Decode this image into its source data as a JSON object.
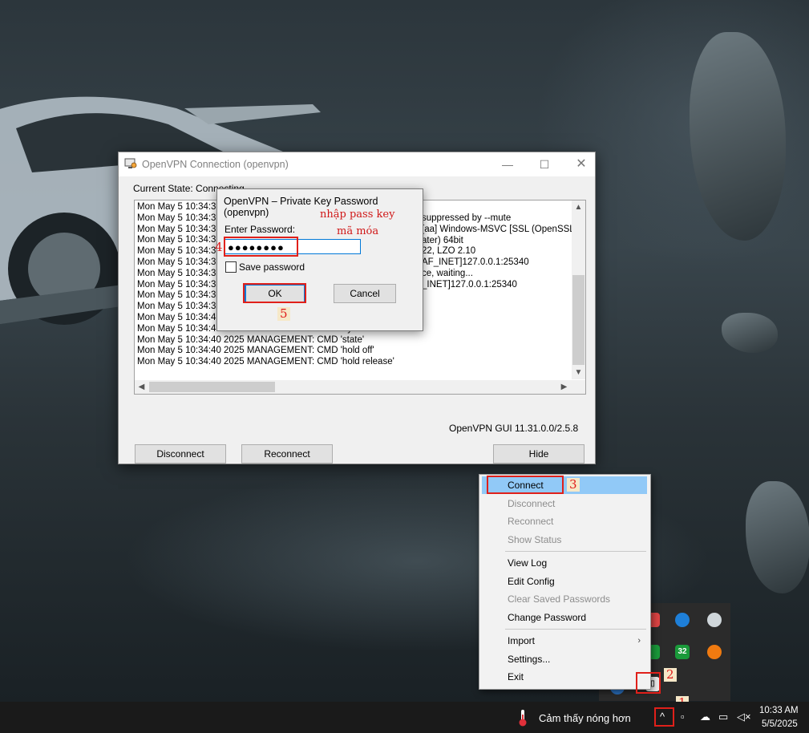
{
  "vpn_window": {
    "title": "OpenVPN Connection (openvpn)",
    "state": "Current State: Connecting",
    "log_left": [
      "Mon May  5 10:34:3",
      "Mon May  5 10:34:3",
      "Mon May  5 10:34:3",
      "Mon May  5 10:34:3",
      "Mon May  5 10:34:3",
      "Mon May  5 10:34:3",
      "Mon May  5 10:34:3",
      "Mon May  5 10:34:3",
      "Mon May  5 10:34:3",
      "Mon May  5 10:34:3",
      "Mon May  5 10:34:4",
      "Mon May  5 10:34:40 2025 MANAGEMENT: CMD 'bytecount 5'",
      "Mon May  5 10:34:40 2025 MANAGEMENT: CMD 'state'",
      "Mon May  5 10:34:40 2025 MANAGEMENT: CMD 'hold off'",
      "Mon May  5 10:34:40 2025 MANAGEMENT: CMD 'hold release'"
    ],
    "log_right": [
      "suppressed by --mute",
      "[aa] Windows-MSVC [SSL (OpenSSL",
      "ater) 64bit",
      "22, LZO 2.10",
      "AF_INET]127.0.0.1:25340",
      "ce, waiting...",
      "_INET]127.0.0.1:25340"
    ],
    "version": "OpenVPN GUI 11.31.0.0/2.5.8",
    "buttons": {
      "disconnect": "Disconnect",
      "reconnect": "Reconnect",
      "hide": "Hide"
    }
  },
  "password_dialog": {
    "title": "OpenVPN – Private Key Password (openvpn)",
    "label": "Enter Password:",
    "value": "●●●●●●●●",
    "save_label": "Save password",
    "save_checked": false,
    "ok": "OK",
    "cancel": "Cancel"
  },
  "annotations": {
    "note_line1": "nhập pass key",
    "note_line2": "mã móa",
    "step1": "1",
    "step2": "2",
    "step3": "3",
    "step4": "4",
    "step5": "5"
  },
  "tray_menu": {
    "items": [
      {
        "label": "Connect",
        "enabled": true,
        "highlighted": true
      },
      {
        "label": "Disconnect",
        "enabled": false
      },
      {
        "label": "Reconnect",
        "enabled": false
      },
      {
        "label": "Show Status",
        "enabled": false
      },
      {
        "label": "View Log",
        "enabled": true
      },
      {
        "label": "Edit Config",
        "enabled": true
      },
      {
        "label": "Clear Saved Passwords",
        "enabled": false
      },
      {
        "label": "Change Password",
        "enabled": true
      },
      {
        "label": "Import",
        "enabled": true,
        "submenu": true
      },
      {
        "label": "Settings...",
        "enabled": true
      },
      {
        "label": "Exit",
        "enabled": true
      }
    ]
  },
  "tray_overflow": {
    "badge_number": "32"
  },
  "taskbar": {
    "weather": "Cảm thấy nóng hơn",
    "time": "10:33 AM",
    "date": "5/5/2025"
  },
  "colors": {
    "highlight": "#91c9f7",
    "annotation_red": "#e0201a",
    "taskbar": "#1a1a1a"
  }
}
